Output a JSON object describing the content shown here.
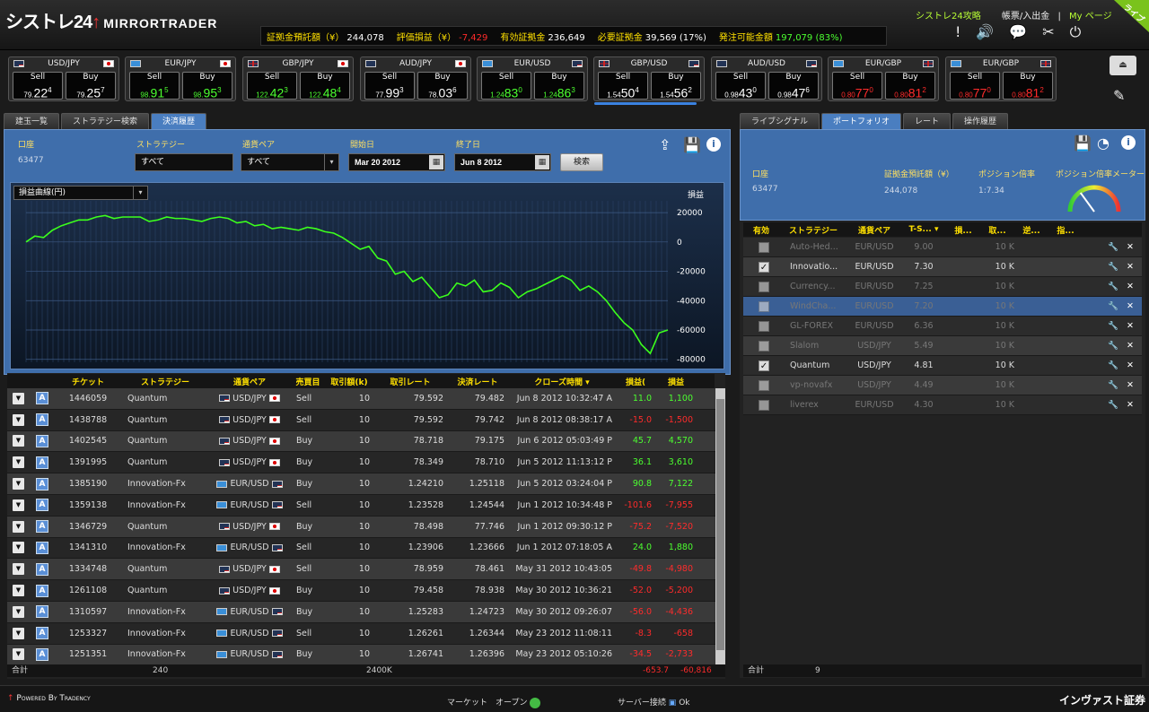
{
  "app": {
    "logo": "シストレ24",
    "brand": "MIRRORTRADER",
    "live_badge": "ライブ"
  },
  "account_bar": [
    {
      "label": "証拠金預託額（¥）",
      "value": "244,078",
      "tone": "normal"
    },
    {
      "label": "評価損益（¥）",
      "value": "-7,429",
      "tone": "neg"
    },
    {
      "label": "有効証拠金",
      "value": "236,649",
      "tone": "normal"
    },
    {
      "label": "必要証拠金",
      "value": "39,569 (17%)",
      "tone": "normal"
    },
    {
      "label": "発注可能金額",
      "value": "197,079 (83%)",
      "tone": "pos"
    }
  ],
  "top_links": {
    "guide": "シストレ24攻略",
    "report": "帳票/入出金",
    "sep": "|",
    "mypage": "My ページ"
  },
  "quotes": [
    {
      "pair": "USD/JPY",
      "f1": "us",
      "f2": "jp",
      "sell_pre": "79.",
      "sell_big": "22",
      "sell_pip": "4",
      "buy_pre": "79.",
      "buy_big": "25",
      "buy_pip": "7",
      "tone": "white"
    },
    {
      "pair": "EUR/JPY",
      "f1": "eu",
      "f2": "jp",
      "sell_pre": "98.",
      "sell_big": "91",
      "sell_pip": "5",
      "buy_pre": "98.",
      "buy_big": "95",
      "buy_pip": "3",
      "tone": "green"
    },
    {
      "pair": "GBP/JPY",
      "f1": "gb",
      "f2": "jp",
      "sell_pre": "122.",
      "sell_big": "42",
      "sell_pip": "3",
      "buy_pre": "122.",
      "buy_big": "48",
      "buy_pip": "4",
      "tone": "green"
    },
    {
      "pair": "AUD/JPY",
      "f1": "au",
      "f2": "jp",
      "sell_pre": "77.",
      "sell_big": "99",
      "sell_pip": "3",
      "buy_pre": "78.",
      "buy_big": "03",
      "buy_pip": "6",
      "tone": "white"
    },
    {
      "pair": "EUR/USD",
      "f1": "eu",
      "f2": "us",
      "sell_pre": "1.24",
      "sell_big": "83",
      "sell_pip": "0",
      "buy_pre": "1.24",
      "buy_big": "86",
      "buy_pip": "3",
      "tone": "green"
    },
    {
      "pair": "GBP/USD",
      "f1": "gb",
      "f2": "us",
      "sell_pre": "1.54",
      "sell_big": "50",
      "sell_pip": "4",
      "buy_pre": "1.54",
      "buy_big": "56",
      "buy_pip": "2",
      "tone": "white"
    },
    {
      "pair": "AUD/USD",
      "f1": "au",
      "f2": "us",
      "sell_pre": "0.98",
      "sell_big": "43",
      "sell_pip": "0",
      "buy_pre": "0.98",
      "buy_big": "47",
      "buy_pip": "6",
      "tone": "white"
    },
    {
      "pair": "EUR/GBP",
      "f1": "eu",
      "f2": "gb",
      "sell_pre": "0.80",
      "sell_big": "77",
      "sell_pip": "0",
      "buy_pre": "0.80",
      "buy_big": "81",
      "buy_pip": "2",
      "tone": "red"
    },
    {
      "pair": "EUR/GBP",
      "f1": "eu",
      "f2": "gb",
      "sell_pre": "0.80",
      "sell_big": "77",
      "sell_pip": "0",
      "buy_pre": "0.80",
      "buy_big": "81",
      "buy_pip": "2",
      "tone": "red"
    }
  ],
  "quote_labels": {
    "sell": "Sell",
    "buy": "Buy"
  },
  "left_tabs": [
    "建玉一覧",
    "ストラテジー検索",
    "決済履歴"
  ],
  "filters": {
    "account_label": "口座",
    "account_value": "63477",
    "strategy_label": "ストラテジー",
    "strategy_value": "すべて",
    "pair_label": "通貨ペア",
    "pair_value": "すべて",
    "start_label": "開始日",
    "start_value": "Mar 20 2012",
    "end_label": "終了日",
    "end_value": "Jun 8 2012",
    "search_button": "検索"
  },
  "chart_data": {
    "type": "line",
    "selector": "損益曲線(円)",
    "ylabel": "損益",
    "yticks": [
      20000,
      0,
      -20000,
      -40000,
      -60000,
      -80000
    ],
    "ylim": [
      -82000,
      28000
    ],
    "series": [
      {
        "values": [
          0,
          4000,
          3000,
          8000,
          11000,
          13000,
          15000,
          15000,
          17000,
          18000,
          16000,
          17000,
          17000,
          17000,
          14000,
          15000,
          17000,
          16000,
          16000,
          15000,
          14000,
          16000,
          17000,
          16000,
          13000,
          14000,
          11000,
          12000,
          9000,
          10000,
          9000,
          8000,
          10000,
          9000,
          7000,
          6000,
          3000,
          -1000,
          -5000,
          -3000,
          -11000,
          -13000,
          -22000,
          -20000,
          -27000,
          -24000,
          -31000,
          -38000,
          -36000,
          -28000,
          -30000,
          -26000,
          -34000,
          -33000,
          -28000,
          -31000,
          -38000,
          -34000,
          -32000,
          -29000,
          -26000,
          -23000,
          -26000,
          -33000,
          -30000,
          -34000,
          -40000,
          -48000,
          -55000,
          -60000,
          -70000,
          -76000,
          -62000,
          -60000
        ]
      }
    ]
  },
  "trade_columns": [
    "",
    "",
    "チケット",
    "ストラテジー",
    "通貨ペア",
    "売買目",
    "取引額(k)",
    "取引レート",
    "決済レート",
    "クローズ時間",
    "損益(",
    "損益"
  ],
  "trades": [
    {
      "ticket": "1446059",
      "strategy": "Quantum",
      "pair": "USD/JPY",
      "f1": "us",
      "f2": "jp",
      "side": "Sell",
      "amount": "10",
      "rate": "79.592",
      "close_rate": "79.482",
      "close_time": "Jun 8 2012 10:32:47 A",
      "pips": "11.0",
      "pl": "1,100",
      "tone": "green"
    },
    {
      "ticket": "1438788",
      "strategy": "Quantum",
      "pair": "USD/JPY",
      "f1": "us",
      "f2": "jp",
      "side": "Sell",
      "amount": "10",
      "rate": "79.592",
      "close_rate": "79.742",
      "close_time": "Jun 8 2012 08:38:17 A",
      "pips": "-15.0",
      "pl": "-1,500",
      "tone": "red"
    },
    {
      "ticket": "1402545",
      "strategy": "Quantum",
      "pair": "USD/JPY",
      "f1": "us",
      "f2": "jp",
      "side": "Buy",
      "amount": "10",
      "rate": "78.718",
      "close_rate": "79.175",
      "close_time": "Jun 6 2012 05:03:49 P",
      "pips": "45.7",
      "pl": "4,570",
      "tone": "green"
    },
    {
      "ticket": "1391995",
      "strategy": "Quantum",
      "pair": "USD/JPY",
      "f1": "us",
      "f2": "jp",
      "side": "Buy",
      "amount": "10",
      "rate": "78.349",
      "close_rate": "78.710",
      "close_time": "Jun 5 2012 11:13:12 P",
      "pips": "36.1",
      "pl": "3,610",
      "tone": "green"
    },
    {
      "ticket": "1385190",
      "strategy": "Innovation-Fx",
      "pair": "EUR/USD",
      "f1": "eu",
      "f2": "us",
      "side": "Buy",
      "amount": "10",
      "rate": "1.24210",
      "close_rate": "1.25118",
      "close_time": "Jun 5 2012 03:24:04 P",
      "pips": "90.8",
      "pl": "7,122",
      "tone": "green"
    },
    {
      "ticket": "1359138",
      "strategy": "Innovation-Fx",
      "pair": "EUR/USD",
      "f1": "eu",
      "f2": "us",
      "side": "Sell",
      "amount": "10",
      "rate": "1.23528",
      "close_rate": "1.24544",
      "close_time": "Jun 1 2012 10:34:48 P",
      "pips": "-101.6",
      "pl": "-7,955",
      "tone": "red"
    },
    {
      "ticket": "1346729",
      "strategy": "Quantum",
      "pair": "USD/JPY",
      "f1": "us",
      "f2": "jp",
      "side": "Buy",
      "amount": "10",
      "rate": "78.498",
      "close_rate": "77.746",
      "close_time": "Jun 1 2012 09:30:12 P",
      "pips": "-75.2",
      "pl": "-7,520",
      "tone": "red"
    },
    {
      "ticket": "1341310",
      "strategy": "Innovation-Fx",
      "pair": "EUR/USD",
      "f1": "eu",
      "f2": "us",
      "side": "Sell",
      "amount": "10",
      "rate": "1.23906",
      "close_rate": "1.23666",
      "close_time": "Jun 1 2012 07:18:05 A",
      "pips": "24.0",
      "pl": "1,880",
      "tone": "green"
    },
    {
      "ticket": "1334748",
      "strategy": "Quantum",
      "pair": "USD/JPY",
      "f1": "us",
      "f2": "jp",
      "side": "Sell",
      "amount": "10",
      "rate": "78.959",
      "close_rate": "78.461",
      "close_time": "May 31 2012 10:43:05",
      "pips": "-49.8",
      "pl": "-4,980",
      "tone": "red"
    },
    {
      "ticket": "1261108",
      "strategy": "Quantum",
      "pair": "USD/JPY",
      "f1": "us",
      "f2": "jp",
      "side": "Buy",
      "amount": "10",
      "rate": "79.458",
      "close_rate": "78.938",
      "close_time": "May 30 2012 10:36:21",
      "pips": "-52.0",
      "pl": "-5,200",
      "tone": "red"
    },
    {
      "ticket": "1310597",
      "strategy": "Innovation-Fx",
      "pair": "EUR/USD",
      "f1": "eu",
      "f2": "us",
      "side": "Buy",
      "amount": "10",
      "rate": "1.25283",
      "close_rate": "1.24723",
      "close_time": "May 30 2012 09:26:07",
      "pips": "-56.0",
      "pl": "-4,436",
      "tone": "red"
    },
    {
      "ticket": "1253327",
      "strategy": "Innovation-Fx",
      "pair": "EUR/USD",
      "f1": "eu",
      "f2": "us",
      "side": "Sell",
      "amount": "10",
      "rate": "1.26261",
      "close_rate": "1.26344",
      "close_time": "May 23 2012 11:08:11",
      "pips": "-8.3",
      "pl": "-658",
      "tone": "red"
    },
    {
      "ticket": "1251351",
      "strategy": "Innovation-Fx",
      "pair": "EUR/USD",
      "f1": "eu",
      "f2": "us",
      "side": "Buy",
      "amount": "10",
      "rate": "1.26741",
      "close_rate": "1.26396",
      "close_time": "May 23 2012 05:10:26",
      "pips": "-34.5",
      "pl": "-2,733",
      "tone": "red"
    }
  ],
  "trade_totals": {
    "label": "合計",
    "count": "240",
    "amount": "2400K",
    "pips": "-653.7",
    "pl": "-60,816"
  },
  "right_tabs": [
    "ライブシグナル",
    "ポートフォリオ",
    "レート",
    "操作履歴"
  ],
  "portfolio": {
    "account_label": "口座",
    "account_value": "63477",
    "deposit_label": "証拠金預託額（¥）",
    "deposit_value": "244,078",
    "leverage_label": "ポジション倍率",
    "leverage_value": "1:7.34",
    "meter_label": "ポジション倍率メーター",
    "meter_level": 0.3
  },
  "portfolio_columns": [
    "有効",
    "ストラテジー",
    "通貨ペア",
    "T-S... ▾",
    "損...",
    "取...",
    "逆...",
    "指..."
  ],
  "portfolio_rows": [
    {
      "checked": false,
      "strategy": "Auto-Hed...",
      "pair": "EUR/USD",
      "ts": "9.00",
      "amount": "10 K",
      "dim": true,
      "selected": false
    },
    {
      "checked": true,
      "strategy": "Innovatio...",
      "pair": "EUR/USD",
      "ts": "7.30",
      "amount": "10 K",
      "dim": false,
      "selected": false
    },
    {
      "checked": false,
      "strategy": "Currency...",
      "pair": "EUR/USD",
      "ts": "7.25",
      "amount": "10 K",
      "dim": true,
      "selected": false
    },
    {
      "checked": false,
      "strategy": "WindCha...",
      "pair": "EUR/USD",
      "ts": "7.20",
      "amount": "10 K",
      "dim": true,
      "selected": true
    },
    {
      "checked": false,
      "strategy": "GL-FOREX",
      "pair": "EUR/USD",
      "ts": "6.36",
      "amount": "10 K",
      "dim": true,
      "selected": false
    },
    {
      "checked": false,
      "strategy": "Slalom",
      "pair": "USD/JPY",
      "ts": "5.49",
      "amount": "10 K",
      "dim": true,
      "selected": false
    },
    {
      "checked": true,
      "strategy": "Quantum",
      "pair": "USD/JPY",
      "ts": "4.81",
      "amount": "10 K",
      "dim": false,
      "selected": false
    },
    {
      "checked": false,
      "strategy": "vp-novafx",
      "pair": "USD/JPY",
      "ts": "4.49",
      "amount": "10 K",
      "dim": true,
      "selected": false
    },
    {
      "checked": false,
      "strategy": "liverex",
      "pair": "EUR/USD",
      "ts": "4.30",
      "amount": "10 K",
      "dim": true,
      "selected": false
    }
  ],
  "portfolio_totals": {
    "label": "合計",
    "count": "9"
  },
  "footer": {
    "powered": "Powered By Tradency",
    "market": "マーケット　オープン",
    "server": "サーバー接続",
    "server_status": "Ok",
    "company": "インヴァスト証券"
  }
}
